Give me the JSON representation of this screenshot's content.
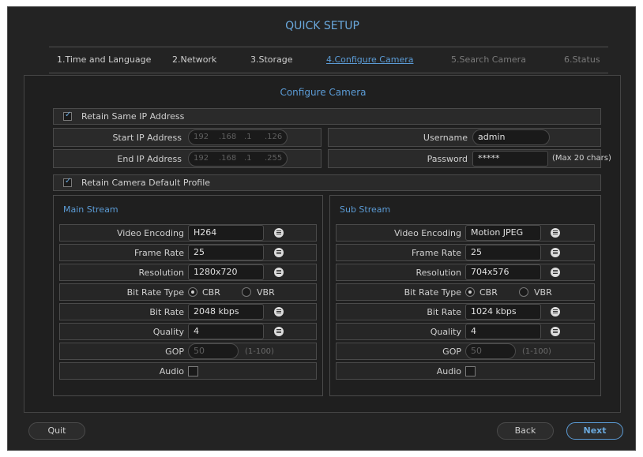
{
  "window": {
    "title": "QUICK SETUP"
  },
  "steps": [
    {
      "label": "1.Time and Language"
    },
    {
      "label": "2.Network"
    },
    {
      "label": "3.Storage"
    },
    {
      "label": "4.Configure Camera"
    },
    {
      "label": "5.Search Camera"
    },
    {
      "label": "6.Status"
    }
  ],
  "configure": {
    "title": "Configure Camera",
    "retain_ip": {
      "label": "Retain Same IP Address",
      "checked": true
    },
    "start_ip": {
      "label": "Start IP Address",
      "segments": [
        "192",
        ".168",
        ".1",
        ".126"
      ]
    },
    "end_ip": {
      "label": "End IP Address",
      "segments": [
        "192",
        ".168",
        ".1",
        ".255"
      ]
    },
    "username": {
      "label": "Username",
      "value": "admin"
    },
    "password": {
      "label": "Password",
      "value": "*****",
      "hint": "(Max 20 chars)"
    },
    "retain_profile": {
      "label": "Retain Camera Default Profile",
      "checked": true
    }
  },
  "main_stream": {
    "title": "Main Stream",
    "video_encoding": {
      "label": "Video Encoding",
      "value": "H264"
    },
    "frame_rate": {
      "label": "Frame Rate",
      "value": "25"
    },
    "resolution": {
      "label": "Resolution",
      "value": "1280x720"
    },
    "bit_rate_type": {
      "label": "Bit Rate Type",
      "options": [
        "CBR",
        "VBR"
      ],
      "selected": "CBR"
    },
    "bit_rate": {
      "label": "Bit Rate",
      "value": "2048 kbps"
    },
    "quality": {
      "label": "Quality",
      "value": "4"
    },
    "gop": {
      "label": "GOP",
      "value": "50",
      "hint": "(1-100)"
    },
    "audio": {
      "label": "Audio",
      "checked": false
    }
  },
  "sub_stream": {
    "title": "Sub Stream",
    "video_encoding": {
      "label": "Video Encoding",
      "value": "Motion JPEG"
    },
    "frame_rate": {
      "label": "Frame Rate",
      "value": "25"
    },
    "resolution": {
      "label": "Resolution",
      "value": "704x576"
    },
    "bit_rate_type": {
      "label": "Bit Rate Type",
      "options": [
        "CBR",
        "VBR"
      ],
      "selected": "CBR"
    },
    "bit_rate": {
      "label": "Bit Rate",
      "value": "1024 kbps"
    },
    "quality": {
      "label": "Quality",
      "value": "4"
    },
    "gop": {
      "label": "GOP",
      "value": "50",
      "hint": "(1-100)"
    },
    "audio": {
      "label": "Audio",
      "checked": false
    }
  },
  "footer": {
    "quit": "Quit",
    "back": "Back",
    "next": "Next"
  },
  "colors": {
    "accent": "#5b9bd5",
    "background": "#232323"
  }
}
